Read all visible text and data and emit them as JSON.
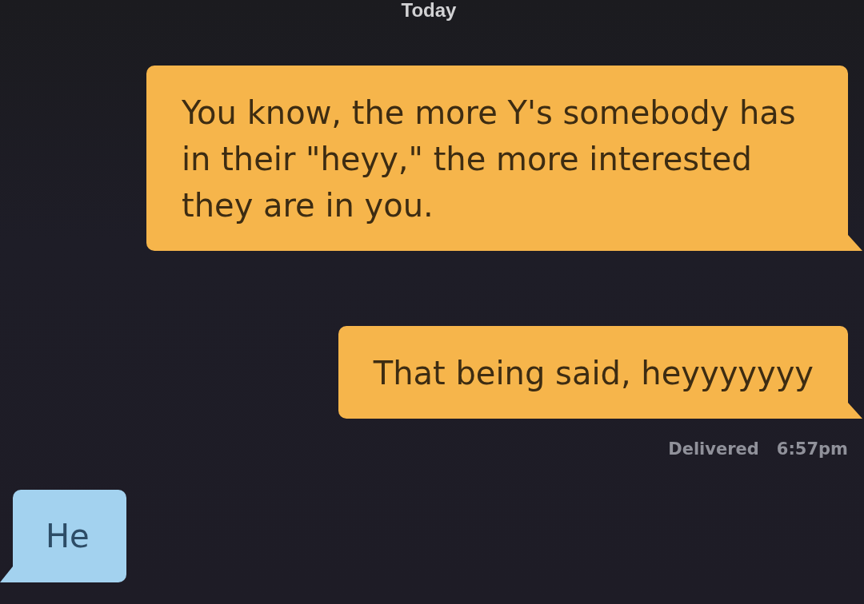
{
  "date_divider": "Today",
  "thread": [
    {
      "kind": "sent",
      "text": "You know, the more Y's somebody has in their \"heyy,\" the more interested they are in you."
    },
    {
      "kind": "sent",
      "text": "That being said, heyyyyyyy"
    },
    {
      "kind": "receipt",
      "status": "Delivered",
      "time": "6:57pm"
    },
    {
      "kind": "received",
      "text": "He"
    }
  ]
}
